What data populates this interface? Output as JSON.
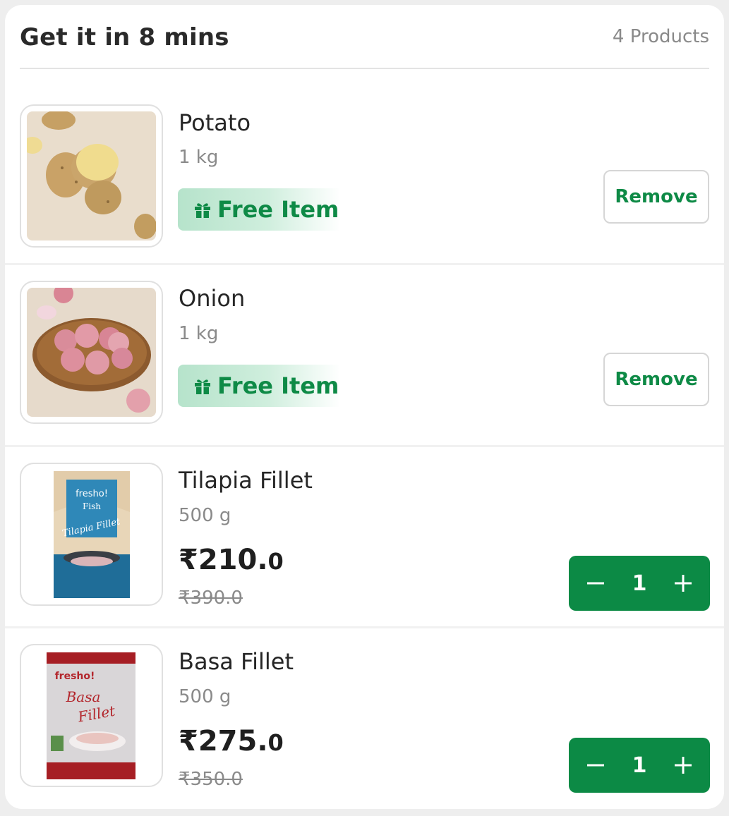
{
  "header": {
    "title": "Get it in 8 mins",
    "count": "4 Products"
  },
  "items": [
    {
      "name": "Potato",
      "quantity": "1 kg",
      "badge": "Free Item",
      "action": "Remove"
    },
    {
      "name": "Onion",
      "quantity": "1 kg",
      "badge": "Free Item",
      "action": "Remove"
    },
    {
      "name": "Tilapia Fillet",
      "quantity": "500 g",
      "price_main": "₹210.",
      "price_decimal": "0",
      "mrp": "₹390.0",
      "count": "1",
      "package": {
        "brand": "fresho!",
        "line": "Fish",
        "title": "Tilapia Fillet"
      }
    },
    {
      "name": "Basa Fillet",
      "quantity": "500 g",
      "price_main": "₹275.",
      "price_decimal": "0",
      "mrp": "₹350.0",
      "count": "1",
      "package": {
        "brand": "fresho!",
        "title1": "Basa",
        "title2": "Fillet"
      }
    }
  ],
  "colors": {
    "accent": "#0c8a45",
    "free_text": "#0e8a46",
    "muted": "#8a8a8a"
  }
}
